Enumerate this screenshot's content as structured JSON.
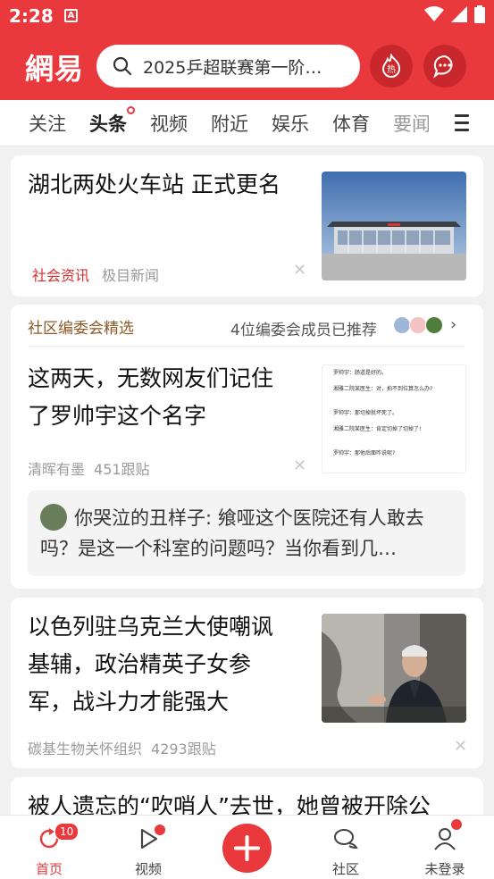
{
  "status_bar": {
    "time": "2:28",
    "notif_glyph": "A"
  },
  "header": {
    "logo": "網易",
    "search_placeholder": "2025乒超联赛第一阶…",
    "hot_label": "热"
  },
  "tabs": [
    {
      "label": "关注"
    },
    {
      "label": "头条"
    },
    {
      "label": "视频"
    },
    {
      "label": "附近"
    },
    {
      "label": "娱乐"
    },
    {
      "label": "体育"
    },
    {
      "label": "要闻"
    }
  ],
  "feed": {
    "item1": {
      "title": "湖北两处火车站 正式更名",
      "tag": "社会资讯",
      "source": "极目新闻"
    },
    "committee": {
      "label": "社区编委会精选",
      "recommend": "4位编委会成员已推荐",
      "title_line1": "这两天，无数网友们记住",
      "title_line2": "了罗帅宇这个名字",
      "source": "清晖有墨",
      "follows": "451跟贴",
      "comment_user": "你哭泣的丑样子:",
      "comment_text": "飨哑这个医院还有人敢去吗？是这一个科室的问题吗？当你看到几…",
      "thumb_lines": [
        "罗帅宇：肠道是好的。",
        "湘雅二院某医生：对，拍不到位算怎么办?",
        "罗帅宇：那切掉就坏死了。",
        "湘雅二院某医生：肯定切掉了切掉了!",
        "罗帅宇：那他后面咋说呢?"
      ]
    },
    "item3": {
      "title_line1": "以色列驻乌克兰大使嘲讽",
      "title_line2": "基辅，政治精英子女参",
      "title_line3": "军，战斗力才能强大",
      "source": "碳基生物关怀组织",
      "follows": "4293跟贴"
    },
    "item4": {
      "title": "被人遗忘的“吹哨人”去世，她曾被开除公"
    }
  },
  "bottom_nav": {
    "home": "首页",
    "home_badge": "10",
    "video": "视频",
    "community": "社区",
    "login": "未登录"
  },
  "colors": {
    "brand": "#e9393d",
    "tag": "#d92d2d"
  }
}
